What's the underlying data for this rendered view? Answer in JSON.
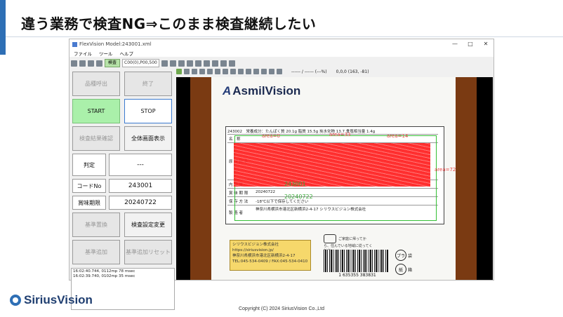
{
  "slide": {
    "title": "違う業務で検査NG⇒このまま検査継続したい",
    "copyright": "Copyright (C) 2024 SiriusVision Co.,Ltd",
    "logo_text": "SiriusVision",
    "accent_color": "#2e6fb5"
  },
  "window": {
    "title": "FlexVision Model:243001.xml",
    "controls": [
      "—",
      "□",
      "✕"
    ],
    "menu": [
      "ファイル",
      "ツール",
      "ヘルプ"
    ],
    "toolbar": {
      "mode_tag": "検査",
      "coords": "C00(0),P00,500"
    }
  },
  "left_panel": {
    "product_call": "品種呼出",
    "finish": "終了",
    "start": "START",
    "stop": "STOP",
    "result_check": "検査結果確認",
    "fullscreen": "全体画面表示",
    "judgement_label": "判定",
    "judgement_value": "---",
    "code_label": "コードNo",
    "code_value": "243001",
    "expiry_label": "賞味期限",
    "expiry_value": "20240722",
    "base_replace": "基準置換",
    "inspection_settings": "検査設定変更",
    "base_add": "基準追加",
    "base_add_reset": "基準追加リセット",
    "log_lines": [
      "16:02:40.744, 0112mp 78 msec",
      "16:02:39.740, 0102mp 35 msec"
    ]
  },
  "viewer": {
    "toolbar_text": "------ / ------ (---%)",
    "coord_readout": "0,0,0  (163, -81)",
    "brand": "AsmilVision",
    "label_code": "243002",
    "nutrition_header": "栄養成分：たんぱく質 20.1g 脂質 15.5g 炭水化物 13.7 食塩相当量 1.4g",
    "rows": [
      {
        "k": "名　称",
        "v": ""
      },
      {
        "k": "原 材 料 名",
        "v": ""
      },
      {
        "k": "内 容 量",
        "v": ""
      },
      {
        "k": "賞 味 期 限",
        "v": "20240722"
      },
      {
        "k": "保 存 方 法",
        "v": "-18℃以下で保存してください"
      },
      {
        "k": "製 造 者",
        "v": "神奈川県横浜市港北区新横浜2-4-17 シリウスビジョン株式会社"
      }
    ],
    "area_labels": [
      "area=0",
      "area=33",
      "area=14",
      "area=72"
    ],
    "code_readout": "243001",
    "expiry_readout": "20240722",
    "note_lines": [
      "シリウスビジョン株式会社",
      "https://siriusvision.jp/",
      "神奈川県横浜市港北区新横浜2-4-17",
      "TEL:045-534-0409 / FAX:045-534-0410"
    ],
    "recycle_text": "ご家庭に帰ってから、住んでいる地域に従ってください",
    "barcode_number": "1  635355  383831",
    "symbol_left": "プラ",
    "symbol_right": "紙",
    "symbol_left_label": "袋",
    "symbol_right_label": "箱"
  }
}
